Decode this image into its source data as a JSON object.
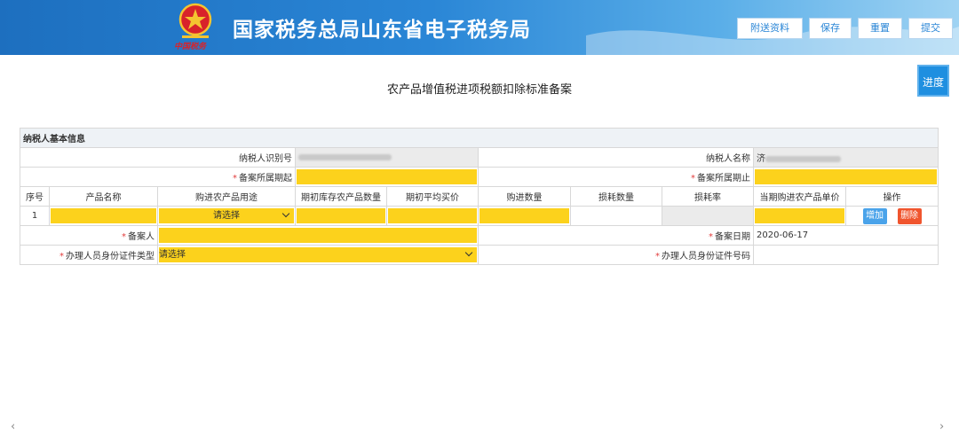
{
  "header": {
    "title": "国家税务总局山东省电子税务局",
    "emblem": "tax-emblem",
    "emblem_caption": "中国税务",
    "buttons": [
      {
        "label": "附送资料"
      },
      {
        "label": "保存"
      },
      {
        "label": "重置"
      },
      {
        "label": "提交"
      }
    ]
  },
  "progress_button": "进度",
  "form_title": "农产品增值税进项税额扣除标准备案",
  "taxpayer_section": {
    "title": "纳税人基本信息",
    "id_label": "纳税人识别号",
    "name_label": "纳税人名称",
    "name_prefix": "济",
    "period_start_label": "备案所属期起",
    "period_end_label": "备案所属期止"
  },
  "product_table": {
    "headers": [
      "序号",
      "产品名称",
      "购进农产品用途",
      "期初库存农产品数量",
      "期初平均买价",
      "购进数量",
      "损耗数量",
      "损耗率",
      "当期购进农产品单价",
      "操作"
    ],
    "rows": [
      {
        "index": "1",
        "usage_select": "请选择"
      }
    ],
    "add_label": "增加",
    "delete_label": "删除"
  },
  "filer": {
    "filer_label": "备案人",
    "date_label": "备案日期",
    "date_value": "2020-06-17",
    "id_type_label": "办理人员身份证件类型",
    "id_type_value": "请选择",
    "id_no_label": "办理人员身份证件号码"
  },
  "colors": {
    "header_blue": "#2a86d6",
    "required_yellow": "#fcd21c",
    "add_blue": "#4aa3ea",
    "delete_red": "#f0552e",
    "required_mark": "#e23c3c"
  },
  "scroll": {
    "left": "‹",
    "right": "›"
  }
}
